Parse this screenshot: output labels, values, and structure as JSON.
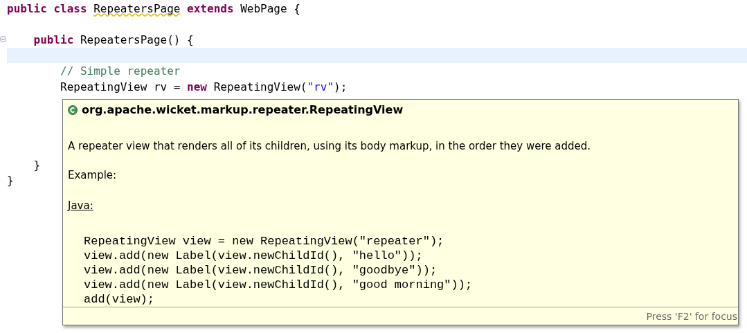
{
  "editor": {
    "lines": [
      {
        "kind": "code",
        "tokens": [
          {
            "kind": "keyword",
            "text": "public class "
          },
          {
            "kind": "plain",
            "text": "RepeatersPage",
            "warning": true
          },
          {
            "kind": "keyword",
            "text": " extends "
          },
          {
            "kind": "plain",
            "text": "WebPage {"
          }
        ],
        "children": [
          {
            "kind": "blank"
          },
          {
            "kind": "code",
            "fold": true,
            "tokens": [
              {
                "kind": "keyword",
                "text": "public "
              },
              {
                "kind": "plain",
                "text": "RepeatersPage() {"
              }
            ],
            "children": [
              {
                "kind": "blank",
                "current": true
              },
              {
                "kind": "code",
                "tokens": [
                  {
                    "kind": "comment",
                    "text": "// Simple repeater"
                  }
                ]
              },
              {
                "kind": "code",
                "tokens": [
                  {
                    "kind": "plain",
                    "text": "RepeatingView "
                  },
                  {
                    "kind": "variable",
                    "text": "rv"
                  },
                  {
                    "kind": "plain",
                    "text": " = "
                  },
                  {
                    "kind": "keyword",
                    "text": "new "
                  },
                  {
                    "kind": "plain",
                    "text": "RepeatingView("
                  },
                  {
                    "kind": "string",
                    "text": "\"rv\""
                  },
                  {
                    "kind": "plain",
                    "text": ");"
                  }
                ]
              },
              {
                "kind": "blank"
              },
              {
                "kind": "blank"
              },
              {
                "kind": "blank"
              },
              {
                "kind": "blank"
              }
            ]
          },
          {
            "kind": "code",
            "tokens": [
              {
                "kind": "plain",
                "text": "}"
              }
            ]
          }
        ]
      },
      {
        "kind": "code",
        "tokens": [
          {
            "kind": "plain",
            "text": "}"
          }
        ]
      }
    ]
  },
  "tooltip": {
    "title": "org.apache.wicket.markup.repeater.RepeatingView",
    "description": "A repeater view that renders all of its children, using its body markup, in the order they were added.",
    "example_label": "Example:",
    "language_label": "Java:",
    "code": [
      "RepeatingView view = new RepeatingView(\"repeater\");",
      "view.add(new Label(view.newChildId(), \"hello\"));",
      "view.add(new Label(view.newChildId(), \"goodbye\"));",
      "view.add(new Label(view.newChildId(), \"good morning\"));",
      "add(view);"
    ],
    "footer": "Press 'F2' for focus"
  }
}
